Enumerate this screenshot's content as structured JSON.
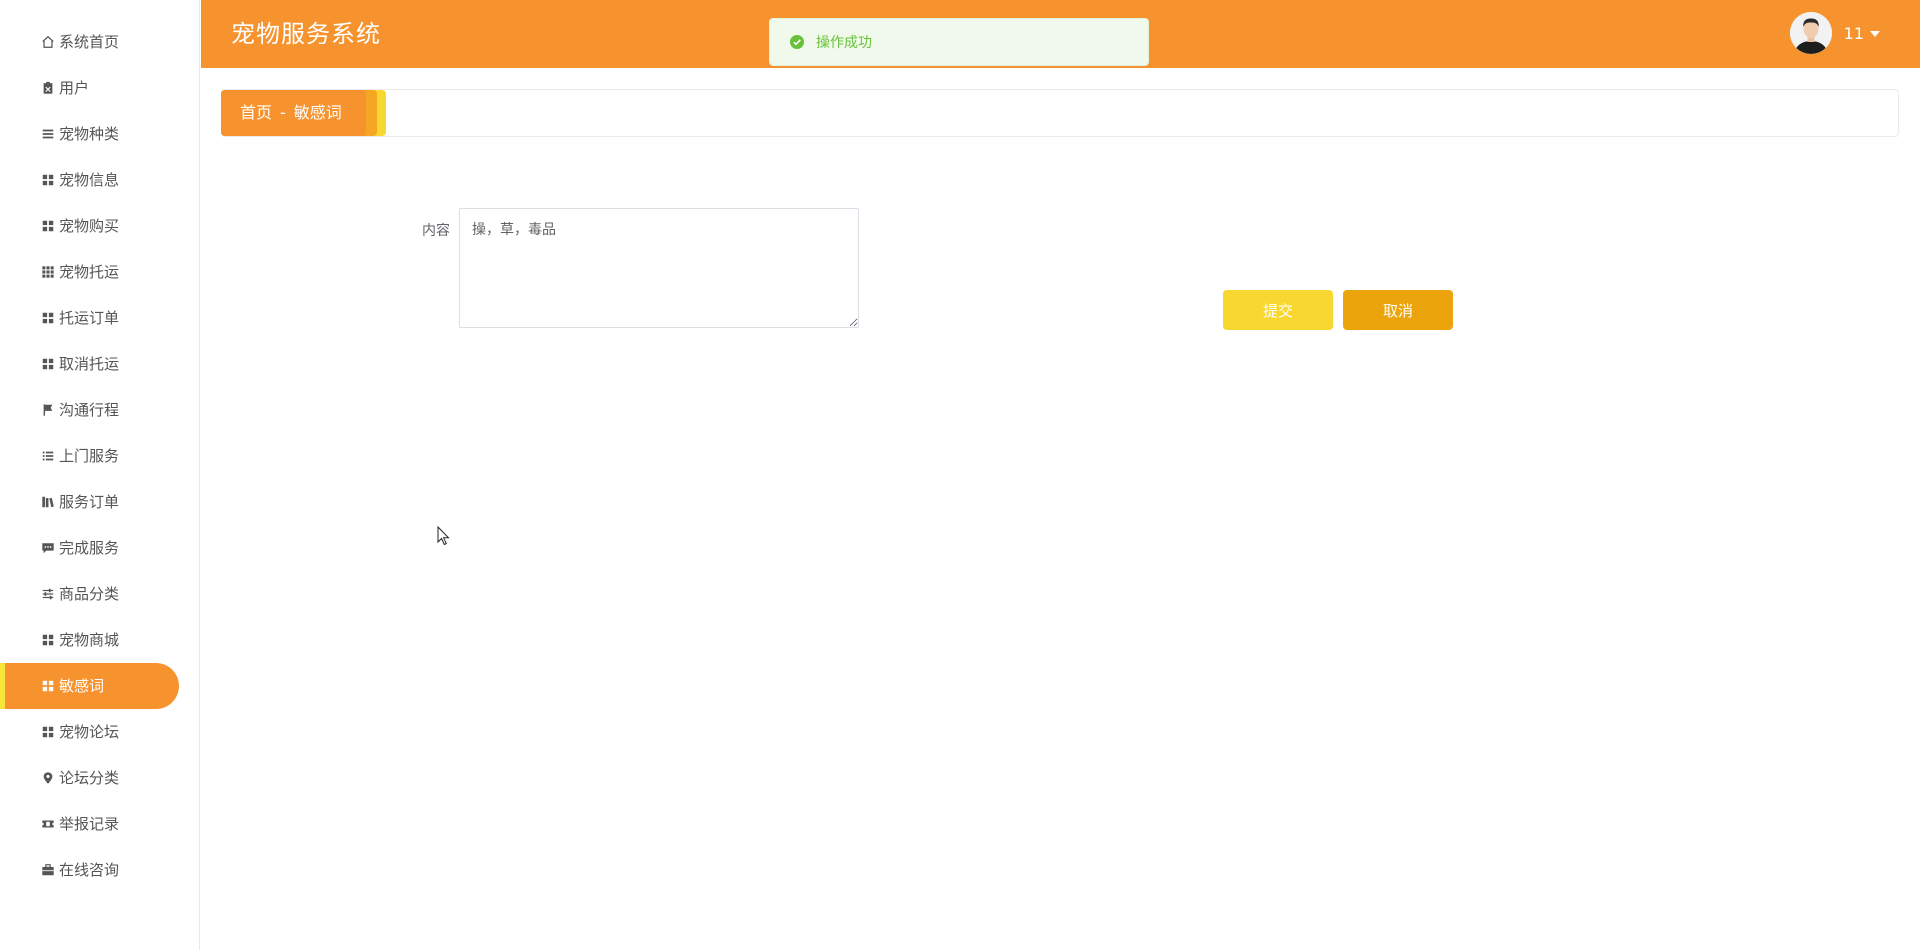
{
  "app": {
    "title": "宠物服务系统"
  },
  "user": {
    "name": "11"
  },
  "toast": {
    "message": "操作成功",
    "type": "success"
  },
  "breadcrumb": {
    "home": "首页",
    "separator": "-",
    "current": "敏感词"
  },
  "sidebar": {
    "items": [
      {
        "label": "系统首页",
        "icon": "home-icon"
      },
      {
        "label": "用户",
        "icon": "clipboard-icon"
      },
      {
        "label": "宠物种类",
        "icon": "bars-icon"
      },
      {
        "label": "宠物信息",
        "icon": "grid-icon"
      },
      {
        "label": "宠物购买",
        "icon": "grid-icon"
      },
      {
        "label": "宠物托运",
        "icon": "grid-nine-icon"
      },
      {
        "label": "托运订单",
        "icon": "grid-icon"
      },
      {
        "label": "取消托运",
        "icon": "grid-icon"
      },
      {
        "label": "沟通行程",
        "icon": "flag-icon"
      },
      {
        "label": "上门服务",
        "icon": "list-icon"
      },
      {
        "label": "服务订单",
        "icon": "books-icon"
      },
      {
        "label": "完成服务",
        "icon": "comment-icon"
      },
      {
        "label": "商品分类",
        "icon": "sliders-icon"
      },
      {
        "label": "宠物商城",
        "icon": "grid-icon"
      },
      {
        "label": "敏感词",
        "icon": "grid-icon",
        "active": true
      },
      {
        "label": "宠物论坛",
        "icon": "grid-icon"
      },
      {
        "label": "论坛分类",
        "icon": "map-pin-icon"
      },
      {
        "label": "举报记录",
        "icon": "ticket-icon"
      },
      {
        "label": "在线咨询",
        "icon": "briefcase-icon"
      }
    ]
  },
  "form": {
    "content_label": "内容",
    "content_value": "操，草，毒品",
    "submit_label": "提交",
    "cancel_label": "取消"
  },
  "colors": {
    "primary": "#f7932f",
    "accent_yellow": "#f8d730",
    "cancel_button": "#eba40b",
    "active_marker": "#f8e53a",
    "toast_text": "#67c23a",
    "toast_bg": "#f0f9eb"
  }
}
